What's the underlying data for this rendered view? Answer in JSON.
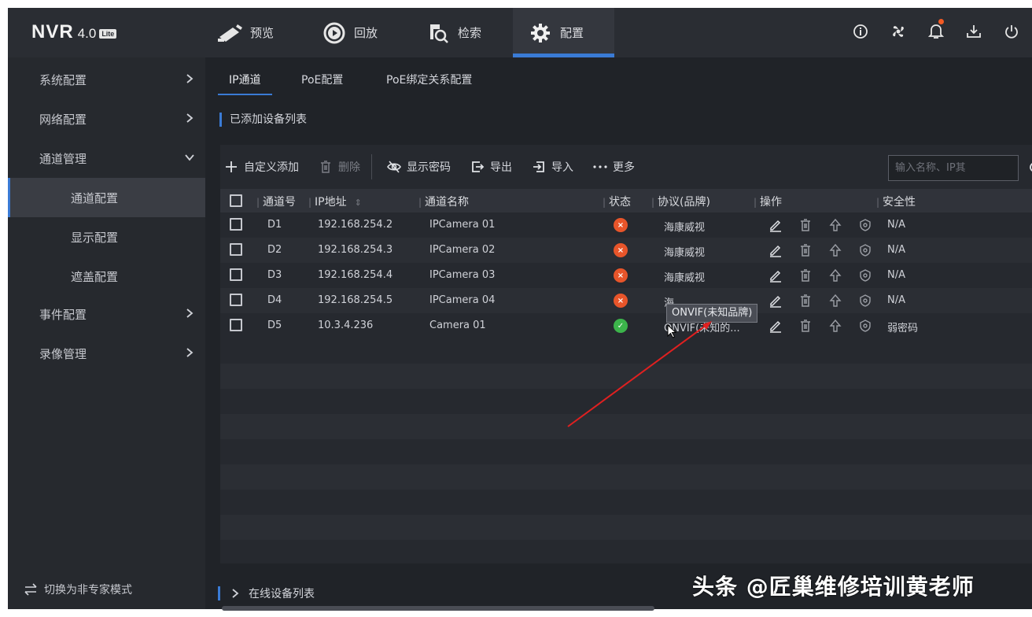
{
  "app": {
    "logo_main": "NVR",
    "logo_version": "4.0",
    "logo_badge": "Lite"
  },
  "nav": {
    "tabs": [
      {
        "label": "预览",
        "icon": "camera-icon"
      },
      {
        "label": "回放",
        "icon": "playback-icon"
      },
      {
        "label": "检索",
        "icon": "search-file-icon"
      },
      {
        "label": "配置",
        "icon": "gear-icon",
        "active": true
      }
    ],
    "right_icons": [
      "info-icon",
      "fan-icon",
      "bell-icon",
      "download-icon",
      "power-icon"
    ]
  },
  "sidebar": {
    "items": [
      {
        "label": "系统配置"
      },
      {
        "label": "网络配置"
      },
      {
        "label": "通道管理"
      },
      {
        "label": "通道配置"
      },
      {
        "label": "显示配置"
      },
      {
        "label": "遮盖配置"
      },
      {
        "label": "事件配置"
      },
      {
        "label": "录像管理"
      }
    ],
    "bottom_label": "切换为非专家模式"
  },
  "subtabs": [
    "IP通道",
    "PoE配置",
    "PoE绑定关系配置"
  ],
  "section_title": "已添加设备列表",
  "toolbar": {
    "add": "自定义添加",
    "delete": "删除",
    "show_password": "显示密码",
    "export": "导出",
    "import": "导入",
    "more": "更多",
    "search_placeholder": "输入名称、IP其"
  },
  "table": {
    "headers": {
      "channel": "通道号",
      "ip": "IP地址",
      "name": "通道名称",
      "status": "状态",
      "protocol": "协议(品牌)",
      "ops": "操作",
      "security": "安全性"
    },
    "rows": [
      {
        "channel": "D1",
        "ip": "192.168.254.2",
        "name": "IPCamera 01",
        "status": "offline",
        "protocol": "海康威视",
        "security": "N/A"
      },
      {
        "channel": "D2",
        "ip": "192.168.254.3",
        "name": "IPCamera 02",
        "status": "offline",
        "protocol": "海康威视",
        "security": "N/A"
      },
      {
        "channel": "D3",
        "ip": "192.168.254.4",
        "name": "IPCamera 03",
        "status": "offline",
        "protocol": "海康威视",
        "security": "N/A"
      },
      {
        "channel": "D4",
        "ip": "192.168.254.5",
        "name": "IPCamera 04",
        "status": "offline",
        "protocol": "海",
        "security": "N/A"
      },
      {
        "channel": "D5",
        "ip": "10.3.4.236",
        "name": "Camera 01",
        "status": "online",
        "protocol": "ONVIF(未知的...",
        "security": "弱密码"
      }
    ]
  },
  "tooltip": "ONVIF(未知品牌)",
  "bottom_bar_label": "在线设备列表",
  "watermark": "头条 @匠巢维修培训黄老师",
  "colors": {
    "accent": "#3a7bd5",
    "offline": "#e8552a",
    "online": "#3cb44b",
    "arrow": "#e02020"
  }
}
